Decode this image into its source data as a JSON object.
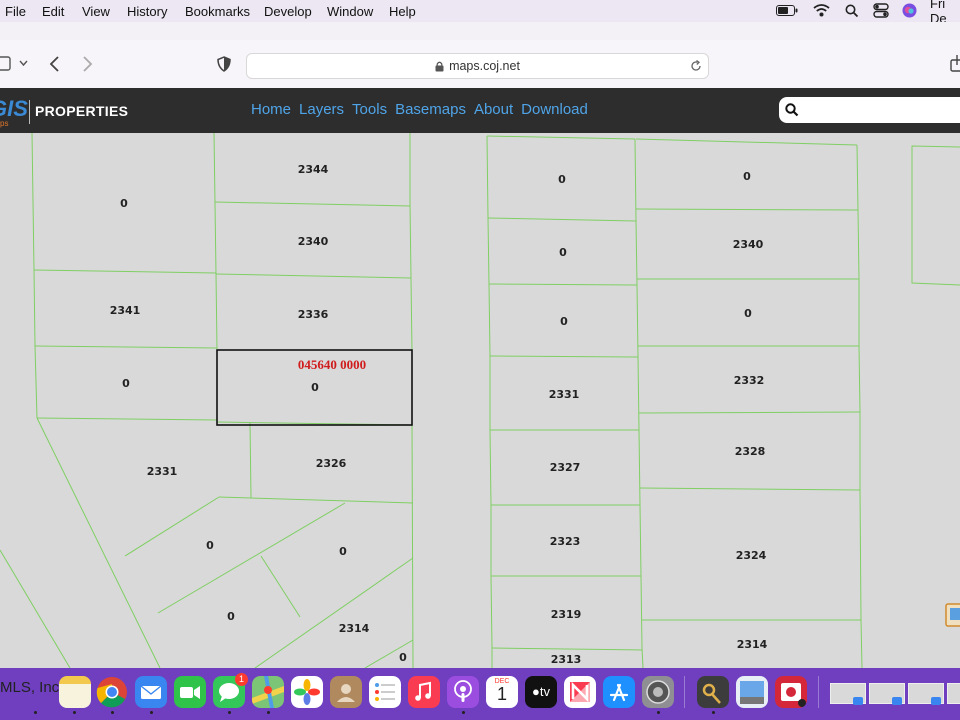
{
  "menubar": {
    "items": [
      "File",
      "Edit",
      "View",
      "History",
      "Bookmarks",
      "Develop",
      "Window",
      "Help"
    ],
    "clock": "Fri De"
  },
  "browser": {
    "url": "maps.coj.net"
  },
  "site": {
    "logo_text": "GIS",
    "logo_sub": "ps",
    "brand": "PROPERTIES",
    "nav": [
      "Home",
      "Layers",
      "Tools",
      "Basemaps",
      "About",
      "Download"
    ],
    "search_placeholder": ""
  },
  "map": {
    "selected_parcel_id": "045640 0000",
    "parcels": [
      {
        "label": "0"
      },
      {
        "label": "2344"
      },
      {
        "label": "2340"
      },
      {
        "label": "2341"
      },
      {
        "label": "2336"
      },
      {
        "label": "0"
      },
      {
        "label": "0"
      },
      {
        "label": "2331"
      },
      {
        "label": "2326"
      },
      {
        "label": "0"
      },
      {
        "label": "0"
      },
      {
        "label": "0"
      },
      {
        "label": "2314"
      },
      {
        "label": "0"
      },
      {
        "label": "0"
      },
      {
        "label": "0"
      },
      {
        "label": "0"
      },
      {
        "label": "2340"
      },
      {
        "label": "0"
      },
      {
        "label": "0"
      },
      {
        "label": "2331"
      },
      {
        "label": "2332"
      },
      {
        "label": "2327"
      },
      {
        "label": "2328"
      },
      {
        "label": "2323"
      },
      {
        "label": "2324"
      },
      {
        "label": "2319"
      },
      {
        "label": "2314"
      },
      {
        "label": "2313"
      }
    ]
  },
  "dock": {
    "first_label": "MLS, Inc.",
    "messages_badge": "1",
    "calendar_month": "DEC",
    "calendar_day": "1",
    "tv_label": "tv"
  }
}
